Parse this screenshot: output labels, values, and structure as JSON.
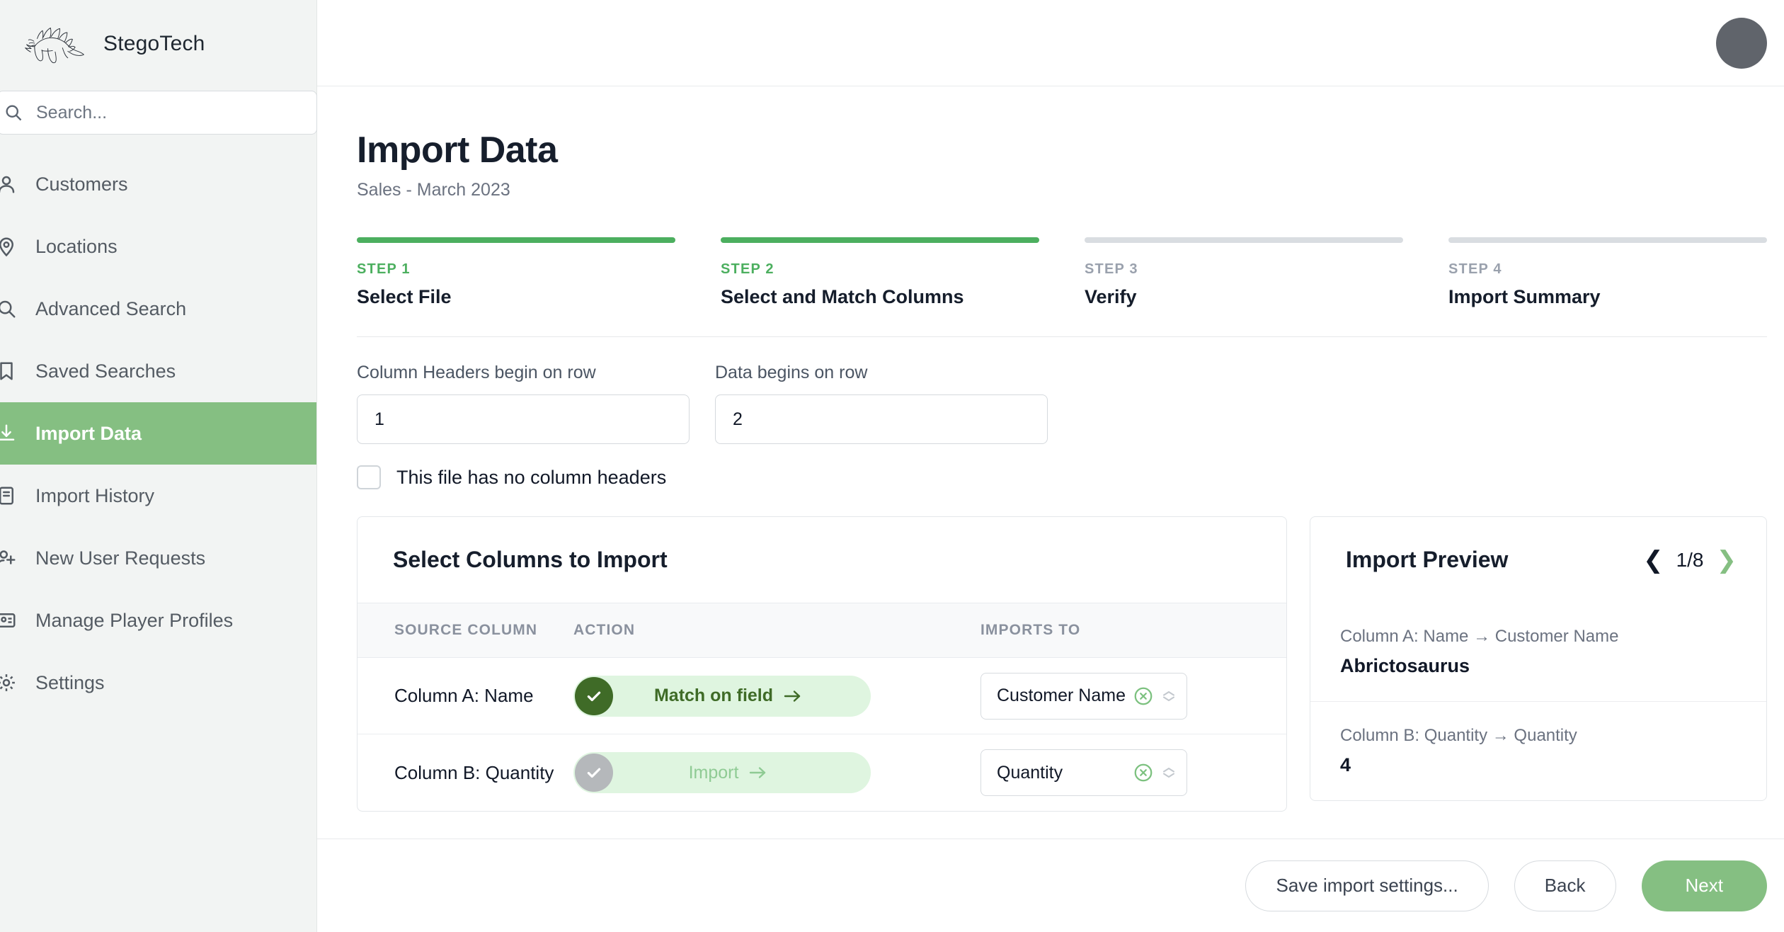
{
  "brand": {
    "name": "StegoTech",
    "logo_icon": "stegosaurus-logo"
  },
  "search": {
    "placeholder": "Search...",
    "icon": "search-icon"
  },
  "sidebar": {
    "items": [
      {
        "label": "Customers",
        "icon": "user-icon",
        "active": false
      },
      {
        "label": "Locations",
        "icon": "map-pin-icon",
        "active": false
      },
      {
        "label": "Advanced Search",
        "icon": "magnifier-icon",
        "active": false
      },
      {
        "label": "Saved Searches",
        "icon": "bookmark-icon",
        "active": false
      },
      {
        "label": "Import Data",
        "icon": "import-icon",
        "active": true
      },
      {
        "label": "Import History",
        "icon": "history-icon",
        "active": false
      },
      {
        "label": "New User Requests",
        "icon": "user-plus-icon",
        "active": false
      },
      {
        "label": "Manage Player Profiles",
        "icon": "id-card-icon",
        "active": false
      },
      {
        "label": "Settings",
        "icon": "gear-icon",
        "active": false
      }
    ]
  },
  "topbar": {
    "avatar_icon": "avatar"
  },
  "page": {
    "title": "Import Data",
    "subtitle": "Sales - March 2023"
  },
  "stepper": {
    "steps": [
      {
        "num": "STEP 1",
        "name": "Select File",
        "done": true
      },
      {
        "num": "STEP 2",
        "name": "Select and Match Columns",
        "done": true
      },
      {
        "num": "STEP 3",
        "name": "Verify",
        "done": false
      },
      {
        "num": "STEP 4",
        "name": "Import Summary",
        "done": false
      }
    ]
  },
  "form": {
    "header_row_label": "Column Headers begin on row",
    "header_row_value": "1",
    "data_row_label": "Data begins on row",
    "data_row_value": "2",
    "no_headers_label": "This file has no column headers",
    "no_headers_checked": false
  },
  "columns_panel": {
    "title": "Select Columns to Import",
    "headers": [
      "SOURCE COLUMN",
      "ACTION",
      "IMPORTS TO"
    ],
    "rows": [
      {
        "source": "Column A: Name",
        "action_label": "Match on field",
        "action_state": "enabled",
        "imports_to": "Customer Name",
        "clear_icon": "circle-x-icon",
        "spinner_icon": "chevron-updown-icon"
      },
      {
        "source": "Column B: Quantity",
        "action_label": "Import",
        "action_state": "muted",
        "imports_to": "Quantity",
        "clear_icon": "circle-x-icon",
        "spinner_icon": "chevron-updown-icon"
      }
    ]
  },
  "preview_panel": {
    "title": "Import Preview",
    "pager": {
      "prev_icon": "chevron-left-icon",
      "position": "1/8",
      "next_icon": "chevron-right-icon"
    },
    "entries": [
      {
        "mapping": "Column A: Name → Customer Name",
        "value": "Abrictosaurus"
      },
      {
        "mapping": "Column B: Quantity → Quantity",
        "value": "4"
      }
    ]
  },
  "footer": {
    "save_label": "Save import settings...",
    "back_label": "Back",
    "next_label": "Next"
  },
  "colors": {
    "accent_green": "#85bf82",
    "step_green": "#4caf5f",
    "pill_bg": "#dff5e0",
    "pill_dark": "#3f6b27",
    "sidebar_bg": "#f2f4f3"
  }
}
